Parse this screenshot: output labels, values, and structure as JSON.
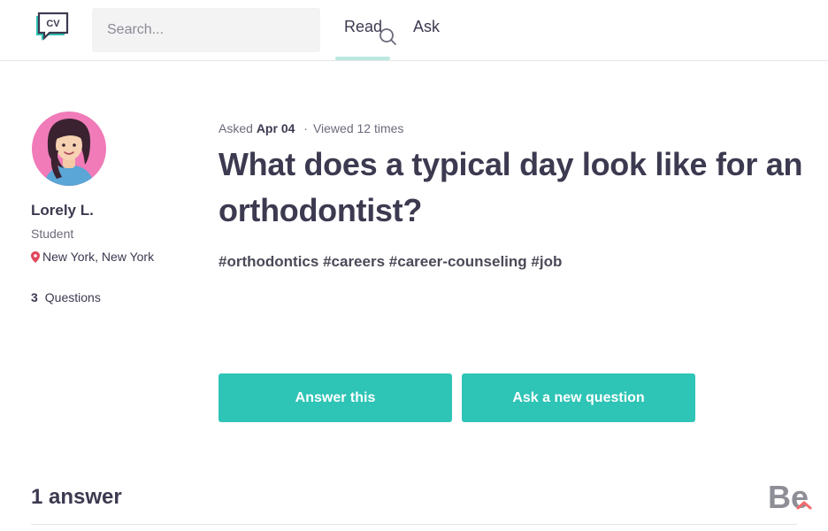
{
  "header": {
    "logo_text": "CV",
    "search": {
      "placeholder": "Search...",
      "value": ""
    },
    "tabs": [
      {
        "label": "Read",
        "active": true
      },
      {
        "label": "Ask",
        "active": false
      }
    ]
  },
  "author": {
    "name": "Lorely L.",
    "role": "Student",
    "location": "New York, New York",
    "questions_count": "3",
    "questions_label": "Questions"
  },
  "question": {
    "asked_label": "Asked",
    "asked_date": "Apr 04",
    "views": "Viewed 12 times",
    "title": "What does a typical day look like for an orthodontist?",
    "tags": [
      "#orthodontics",
      "#careers",
      "#career-counseling",
      "#job"
    ]
  },
  "actions": {
    "answer_label": "Answer this",
    "ask_label": "Ask a new question"
  },
  "answers": {
    "heading": "1 answer"
  },
  "watermark": {
    "text": "Be"
  },
  "colors": {
    "accent": "#2ec4b6",
    "tab_underline": "#b9e8e0",
    "text_primary": "#3c3a50",
    "location_pin": "#e0475c"
  }
}
